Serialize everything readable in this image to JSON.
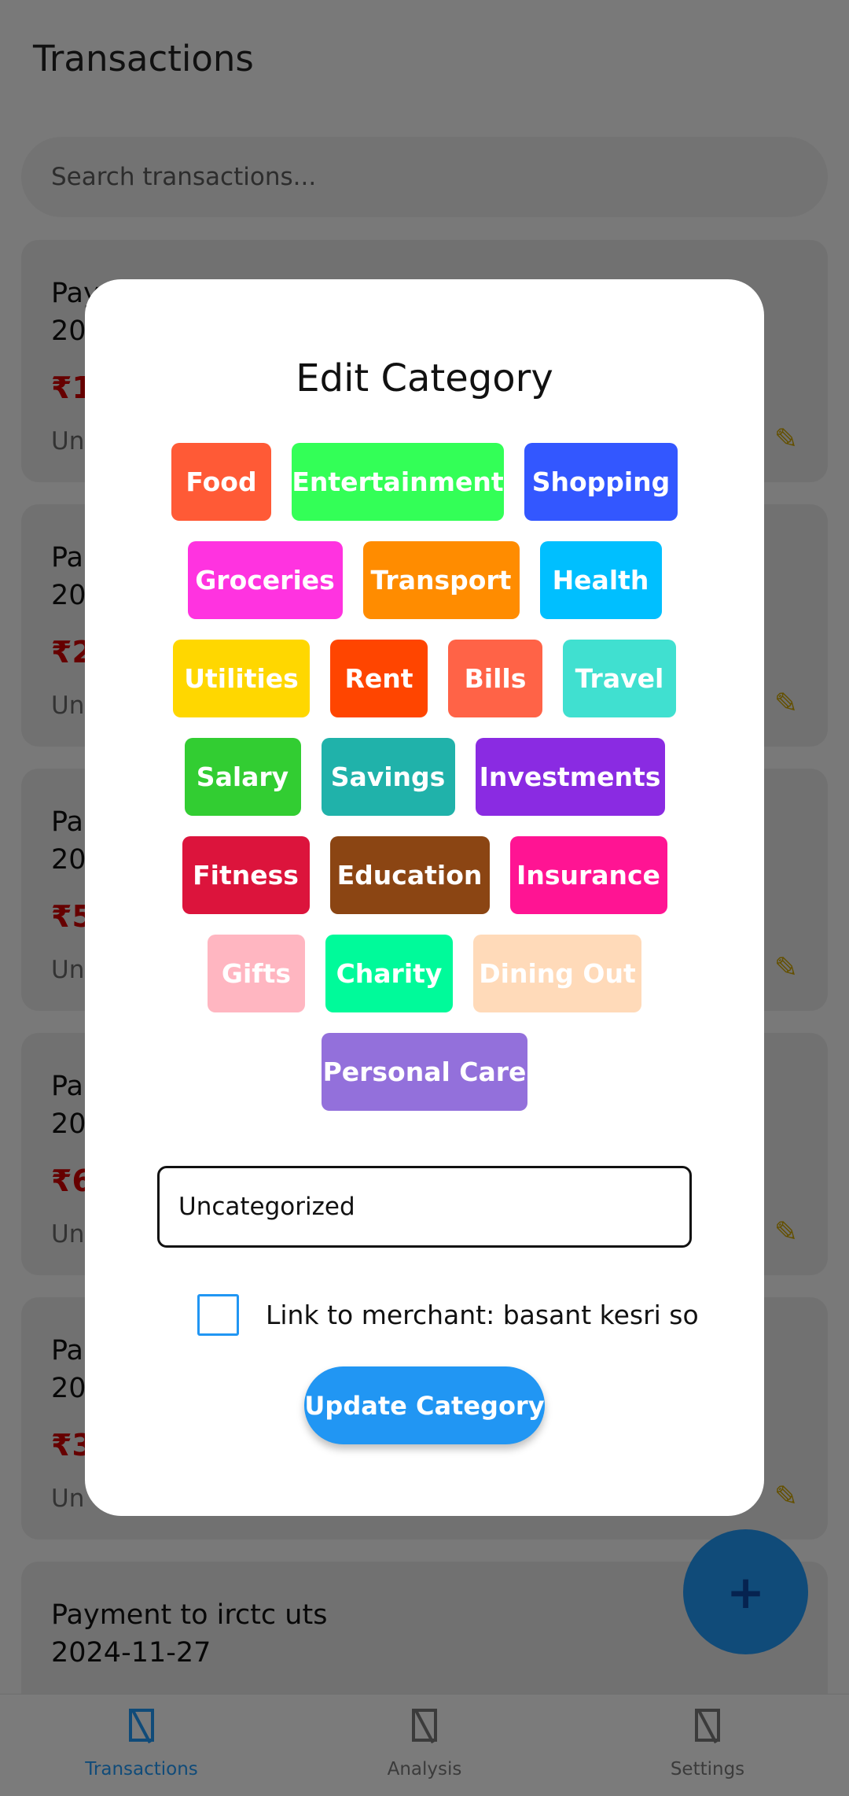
{
  "header": {
    "title": "Transactions"
  },
  "search": {
    "placeholder": "Search transactions..."
  },
  "transactions": [
    {
      "title": "Pay",
      "date": "20",
      "amount": "₹1",
      "category": "Un"
    },
    {
      "title": "Pa",
      "date": "20",
      "amount": "₹2",
      "category": "Un"
    },
    {
      "title": "Pa",
      "date": "20",
      "amount": "₹5",
      "category": "Un"
    },
    {
      "title": "Pa",
      "date": "20",
      "amount": "₹6",
      "category": "Un"
    },
    {
      "title": "Pa",
      "date": "20",
      "amount": "₹3",
      "category": "Un"
    },
    {
      "title": "Payment to irctc uts",
      "date": "2024-11-27",
      "amount": "",
      "category": ""
    }
  ],
  "edit_icon": "pencil-icon",
  "fab": {
    "label": "+",
    "icon": "plus-icon"
  },
  "bottom_nav": [
    {
      "label": "Transactions",
      "icon": "receipt-icon",
      "active": true
    },
    {
      "label": "Analysis",
      "icon": "chart-icon",
      "active": false
    },
    {
      "label": "Settings",
      "icon": "gear-icon",
      "active": false
    }
  ],
  "modal": {
    "title": "Edit Category",
    "categories": [
      {
        "label": "Food",
        "color": "#ff5a36"
      },
      {
        "label": "Entertainment",
        "color": "#33ff57"
      },
      {
        "label": "Shopping",
        "color": "#3357ff"
      },
      {
        "label": "Groceries",
        "color": "#ff33e0"
      },
      {
        "label": "Transport",
        "color": "#ff8c00"
      },
      {
        "label": "Health",
        "color": "#00bfff"
      },
      {
        "label": "Utilities",
        "color": "#ffd700"
      },
      {
        "label": "Rent",
        "color": "#ff4500"
      },
      {
        "label": "Bills",
        "color": "#ff6347"
      },
      {
        "label": "Travel",
        "color": "#40e0d0"
      },
      {
        "label": "Salary",
        "color": "#32cd32"
      },
      {
        "label": "Savings",
        "color": "#20b2aa"
      },
      {
        "label": "Investments",
        "color": "#8a2be2"
      },
      {
        "label": "Fitness",
        "color": "#dc143c"
      },
      {
        "label": "Education",
        "color": "#8b4513"
      },
      {
        "label": "Insurance",
        "color": "#ff1493"
      },
      {
        "label": "Gifts",
        "color": "#ffb6c1"
      },
      {
        "label": "Charity",
        "color": "#00fa9a"
      },
      {
        "label": "Dining Out",
        "color": "#ffdab9"
      },
      {
        "label": "Personal Care",
        "color": "#9370db"
      }
    ],
    "category_input_value": "Uncategorized",
    "link_label": "Link to merchant: basant kesri so",
    "link_checked": false,
    "update_label": "Update Category"
  },
  "colors": {
    "accent": "#2196f3",
    "amount": "#cc0000"
  }
}
